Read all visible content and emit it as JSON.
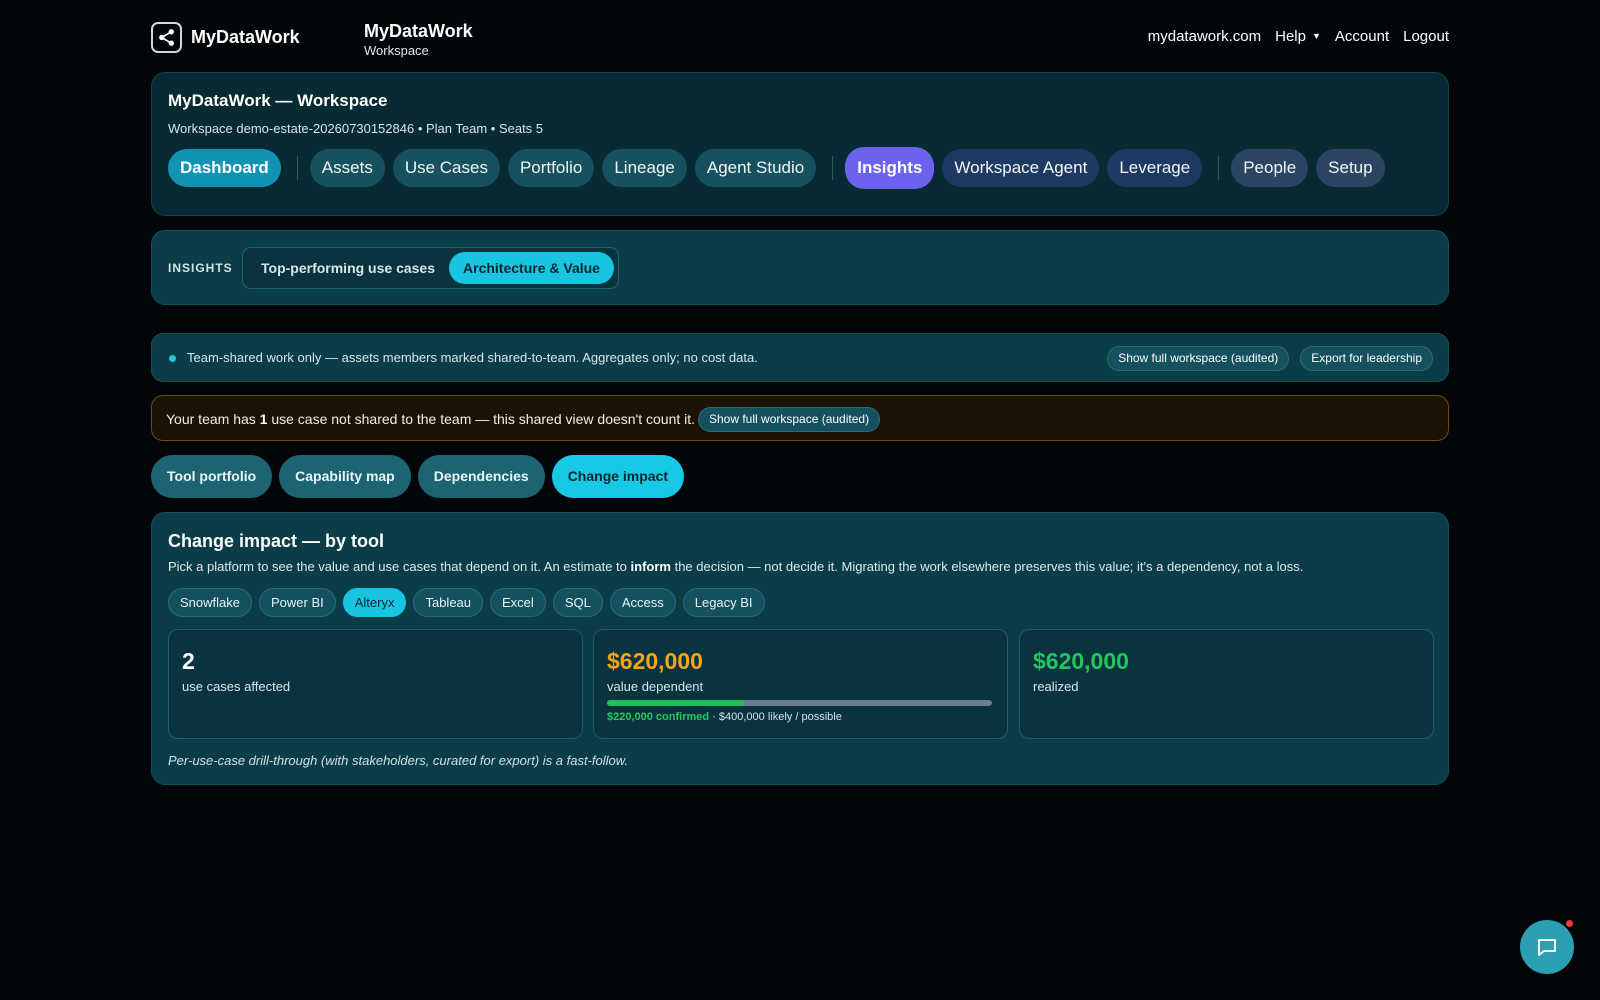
{
  "topbar": {
    "logo_text": "MyDataWork",
    "brand_title": "MyDataWork",
    "brand_sub": "Workspace",
    "nav": {
      "site": "mydatawork.com",
      "help": "Help",
      "account": "Account",
      "logout": "Logout"
    }
  },
  "header": {
    "title": "MyDataWork — Workspace",
    "subtitle": "Workspace demo-estate-20260730152846 • Plan Team • Seats 5",
    "tabs": [
      "Dashboard",
      "Assets",
      "Use Cases",
      "Portfolio",
      "Lineage",
      "Agent Studio",
      "Insights",
      "Workspace Agent",
      "Leverage",
      "People",
      "Setup"
    ],
    "active_tab": "Insights"
  },
  "insights": {
    "label": "INSIGHTS",
    "segments": [
      "Top-performing use cases",
      "Architecture & Value"
    ],
    "active_segment": "Architecture & Value"
  },
  "notice": {
    "text": "Team-shared work only — assets members marked shared-to-team. Aggregates only; no cost data.",
    "show_full": "Show full workspace (audited)",
    "export": "Export for leadership"
  },
  "warning": {
    "prefix": "Your team has ",
    "count": "1",
    "suffix": " use case not shared to the team — this shared view doesn't count it.",
    "button": "Show full workspace (audited)"
  },
  "subtabs": {
    "items": [
      "Tool portfolio",
      "Capability map",
      "Dependencies",
      "Change impact"
    ],
    "active": "Change impact"
  },
  "impact": {
    "title": "Change impact — by tool",
    "desc_pre": "Pick a platform to see the value and use cases that depend on it. An estimate to ",
    "desc_bold": "inform",
    "desc_post": " the decision — not decide it. Migrating the work elsewhere preserves this value; it's a dependency, not a loss.",
    "tools": [
      "Snowflake",
      "Power BI",
      "Alteryx",
      "Tableau",
      "Excel",
      "SQL",
      "Access",
      "Legacy BI"
    ],
    "active_tool": "Alteryx",
    "stats": {
      "affected_value": "2",
      "affected_label": "use cases affected",
      "dependent_value": "$620,000",
      "dependent_label": "value dependent",
      "confirmed_text": "$220,000 confirmed",
      "likely_text": " · $400,000 likely / possible",
      "confirmed_fraction": 0.3548,
      "realized_value": "$620,000",
      "realized_label": "realized"
    },
    "footnote": "Per-use-case drill-through (with stakeholders, curated for export) is a fast-follow."
  },
  "colors": {
    "accent_teal": "#17c5e0",
    "accent_purple": "#6b63ee",
    "stat_white": "#ffffff",
    "stat_orange": "#f5a317",
    "stat_green": "#22c55e"
  },
  "icons": {
    "logo": "share-nodes-icon",
    "chat": "chat-bubble-icon",
    "help_caret": "caret-down-icon"
  }
}
